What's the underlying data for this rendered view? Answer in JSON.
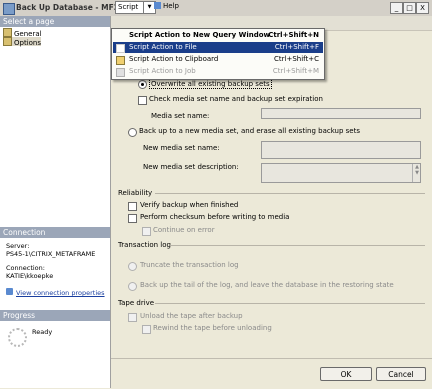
{
  "window": {
    "title": "Back Up Database - MF20",
    "minimize": "_",
    "maximize": "□",
    "close": "X"
  },
  "left": {
    "select_page": "Select a page",
    "pages": [
      "General",
      "Options"
    ],
    "connection_header": "Connection",
    "server_label": "Server:",
    "server_value": "PS45-1\\CITRIX_METAFRAME",
    "connection_label": "Connection:",
    "connection_value": "KATIE\\kkoepke",
    "view_props": "View connection properties",
    "progress_header": "Progress",
    "progress_status": "Ready"
  },
  "toolbar": {
    "script": "Script",
    "help": "Help"
  },
  "script_menu": [
    {
      "label": "Script Action to New Query Window",
      "shortcut": "Ctrl+Shift+N"
    },
    {
      "label": "Script Action to File",
      "shortcut": "Ctrl+Shift+F"
    },
    {
      "label": "Script Action to Clipboard",
      "shortcut": "Ctrl+Shift+C"
    },
    {
      "label": "Script Action to Job",
      "shortcut": "Ctrl+Shift+M"
    }
  ],
  "overwrite": {
    "append_partial": "Ap",
    "overwrite_all": "Overwrite all existing backup sets",
    "check_media": "Check media set name and backup set expiration",
    "media_set_name": "Media set name:",
    "new_media_set": "Back up to a new media set, and erase all existing backup sets",
    "new_media_set_name": "New media set name:",
    "new_media_set_desc": "New media set description:"
  },
  "reliability": {
    "header": "Reliability",
    "verify": "Verify backup when finished",
    "checksum": "Perform checksum before writing to media",
    "continue_on_error": "Continue on error"
  },
  "transaction_log": {
    "header": "Transaction log",
    "truncate": "Truncate the transaction log",
    "tail": "Back up the tail of the log, and leave the database in the restoring state"
  },
  "tape_drive": {
    "header": "Tape drive",
    "unload": "Unload the tape after backup",
    "rewind": "Rewind the tape before unloading"
  },
  "buttons": {
    "ok": "OK",
    "cancel": "Cancel"
  }
}
